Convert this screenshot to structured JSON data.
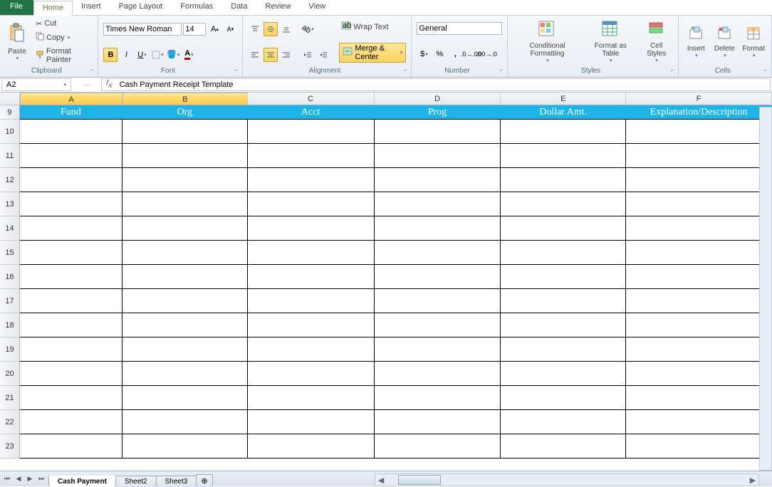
{
  "tabs": {
    "file": "File",
    "home": "Home",
    "insert": "Insert",
    "pagelayout": "Page Layout",
    "formulas": "Formulas",
    "data": "Data",
    "review": "Review",
    "view": "View"
  },
  "clipboard": {
    "paste": "Paste",
    "cut": "Cut",
    "copy": "Copy",
    "formatpainter": "Format Painter",
    "label": "Clipboard"
  },
  "font": {
    "name": "Times New Roman",
    "size": "14",
    "label": "Font"
  },
  "alignment": {
    "wrap": "Wrap Text",
    "merge": "Merge & Center",
    "label": "Alignment"
  },
  "number": {
    "format": "General",
    "label": "Number"
  },
  "styles": {
    "cond": "Conditional Formatting",
    "table": "Format as Table",
    "cell": "Cell Styles",
    "label": "Styles"
  },
  "cells": {
    "insert": "Insert",
    "delete": "Delete",
    "format": "Format",
    "label": "Cells"
  },
  "namebox": "A2",
  "formula": "Cash Payment Receipt Template",
  "cols": [
    "A",
    "B",
    "C",
    "D",
    "E",
    "F"
  ],
  "headerRow": {
    "num": "9",
    "cells": [
      "Fund",
      "Org",
      "Acct",
      "Prog",
      "Dollar Amt.",
      "Explanation/Description"
    ]
  },
  "rows": [
    "10",
    "11",
    "12",
    "13",
    "14",
    "15",
    "16",
    "17",
    "18",
    "19",
    "20",
    "21",
    "22",
    "23"
  ],
  "sheets": {
    "s1": "Cash Payment",
    "s2": "Sheet2",
    "s3": "Sheet3"
  }
}
